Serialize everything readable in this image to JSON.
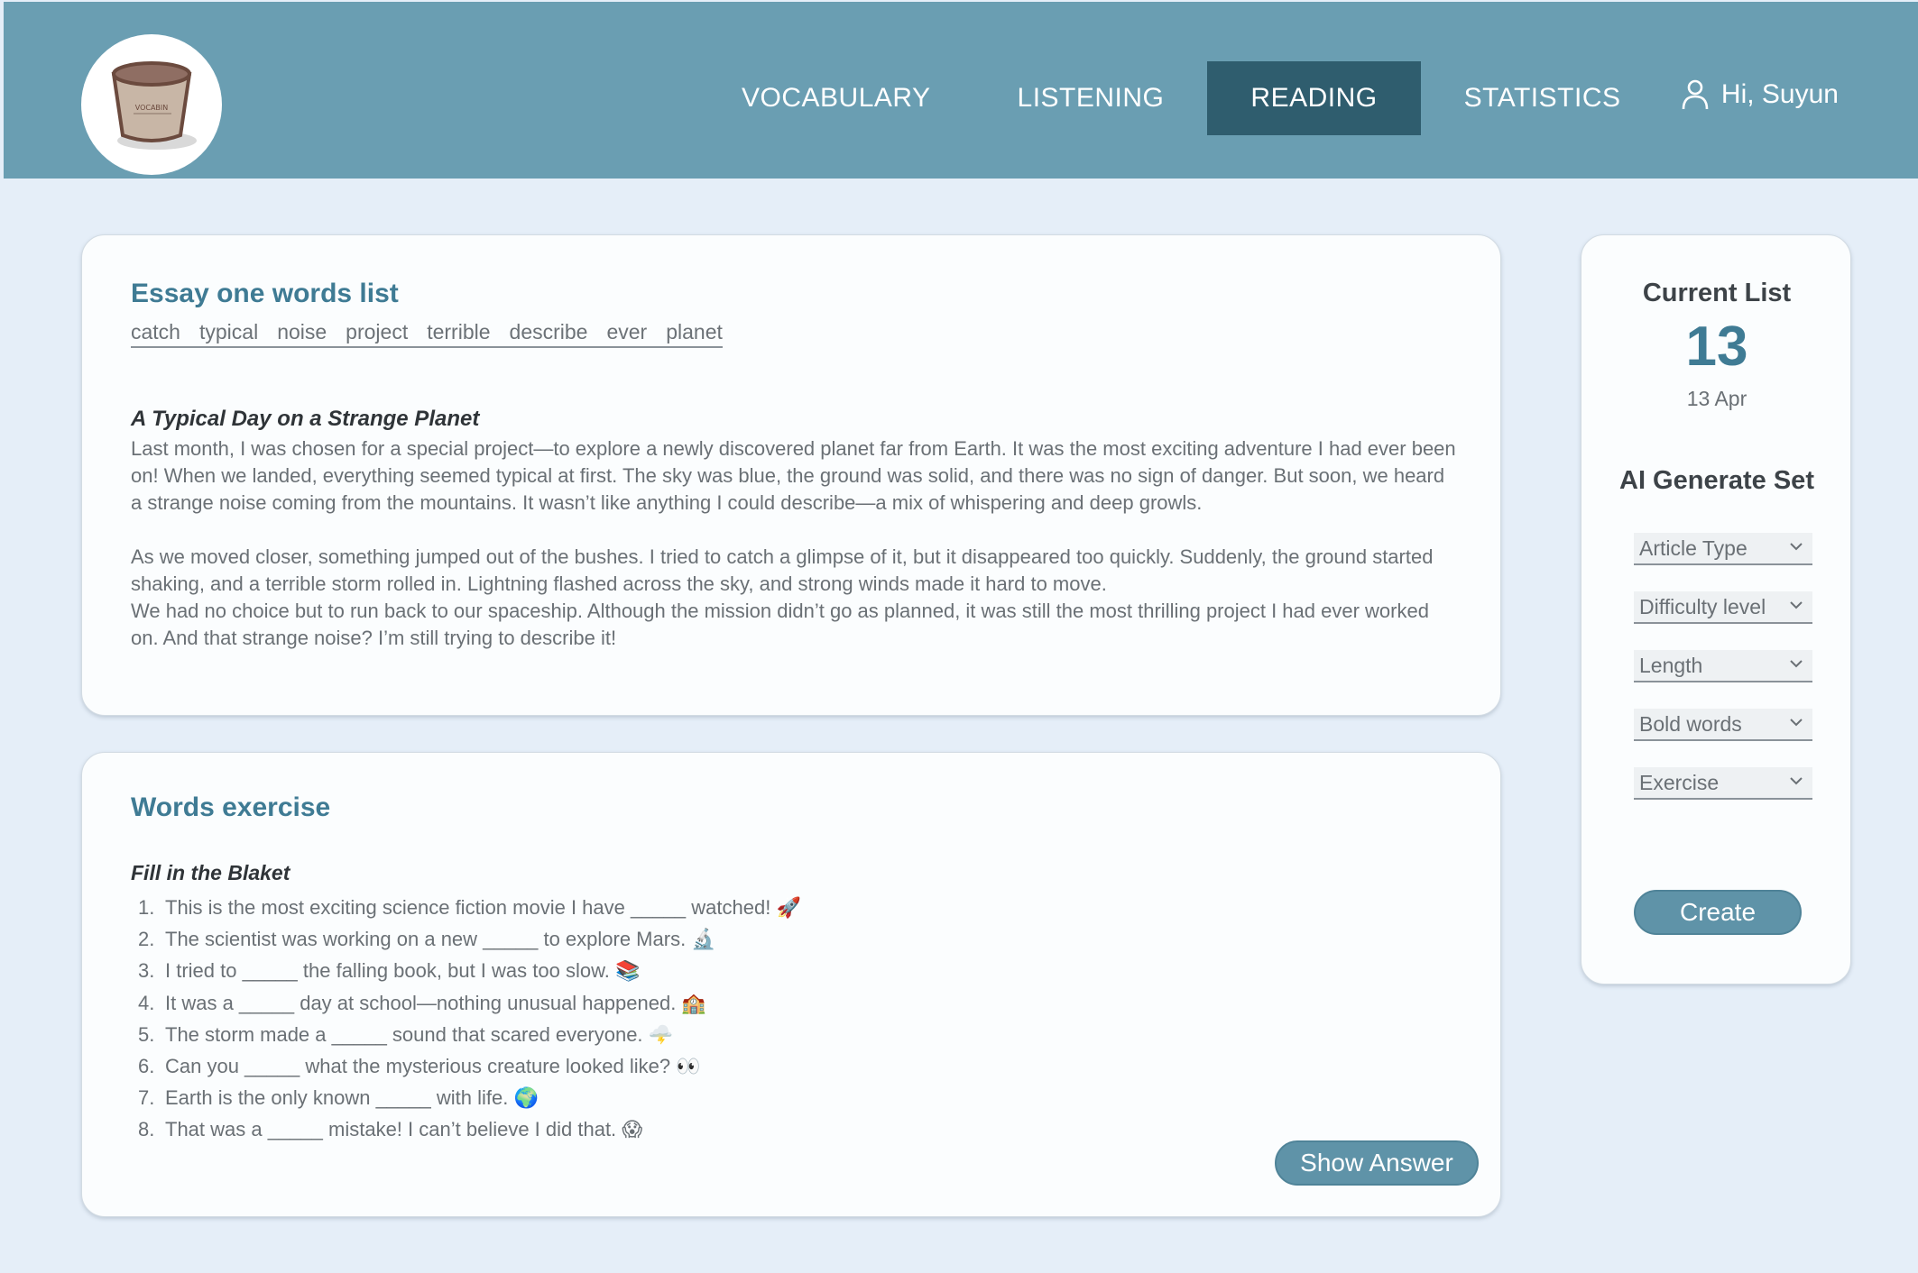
{
  "header": {
    "nav": [
      "VOCABULARY",
      "LISTENING",
      "READING",
      "STATISTICS"
    ],
    "active_nav": "READING",
    "greeting": "Hi, Suyun",
    "logo_text": "VOCABIN",
    "bg_color": "#6a9eb2",
    "active_color": "#2f5d6e"
  },
  "essay": {
    "title": "Essay one words list",
    "words": [
      "catch",
      "typical",
      "noise",
      "project",
      "terrible",
      "describe",
      "ever",
      "planet"
    ],
    "article_title": "A Typical Day on a Strange Planet",
    "paragraphs": [
      "Last month, I was chosen for a special project—to explore a newly discovered planet far from Earth. It was the most exciting adventure I had ever been on! When we landed, everything seemed typical at first. The sky was blue, the ground was solid, and there was no sign of danger. But soon, we heard a strange noise coming from the mountains. It wasn’t like anything I could describe—a mix of whispering and deep growls.",
      "As we moved closer, something jumped out of the bushes. I tried to catch a glimpse of it, but it disappeared too quickly. Suddenly, the ground started shaking, and a terrible storm rolled in. Lightning flashed across the sky, and strong winds made it hard to move.",
      "We had no choice but to run back to our spaceship. Although the mission didn’t go as planned, it was still the most thrilling project I had ever worked on. And that strange noise? I’m still trying to describe it!"
    ]
  },
  "exercise": {
    "title": "Words exercise",
    "heading": "Fill in the Blaket",
    "items": [
      "This is the most exciting science fiction movie I have _____ watched! 🚀",
      "The scientist was working on a new _____ to explore Mars. 🔬",
      "I tried to _____ the falling book, but I was too slow. 📚",
      "It was a _____ day at school—nothing unusual happened. 🏫",
      "The storm made a _____ sound that scared everyone. 🌩️",
      "Can you _____ what the mysterious creature looked like? 👀",
      "Earth is the only known _____ with life. 🌍",
      "That was a _____ mistake! I can’t believe I did that. 😱"
    ],
    "show_answer_label": "Show Answer"
  },
  "sidebar": {
    "current_title": "Current List",
    "current_number": "13",
    "current_date": "13 Apr",
    "ai_title": "AI Generate Set",
    "selects": [
      "Article Type",
      "Difficulty level",
      "Length",
      "Bold words",
      "Exercise"
    ],
    "create_label": "Create"
  },
  "icons": {
    "logo": "bucket-logo-icon",
    "user": "user-icon",
    "dropdown": "chevron-down-icon"
  }
}
